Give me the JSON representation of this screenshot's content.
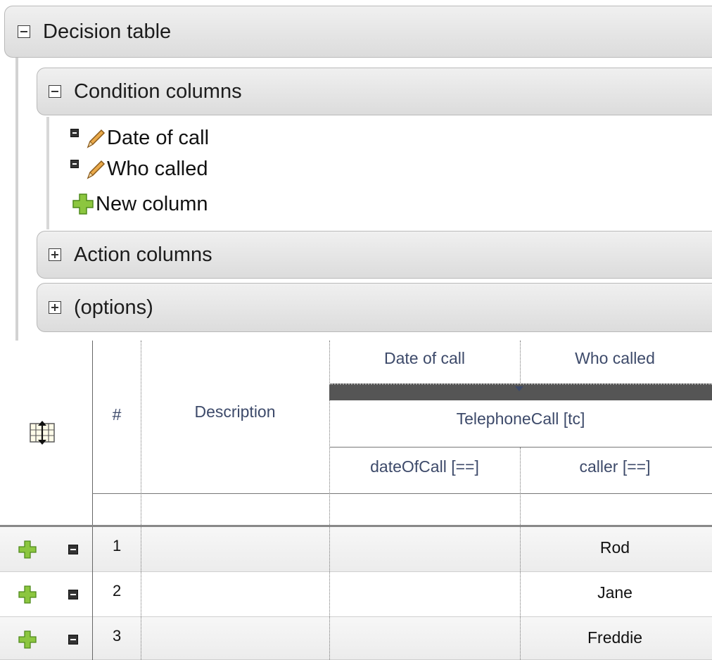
{
  "decision_table": {
    "title": "Decision table"
  },
  "condition_columns": {
    "title": "Condition columns",
    "items": [
      {
        "label": "Date of call"
      },
      {
        "label": "Who called"
      }
    ],
    "new_column_label": "New column"
  },
  "action_columns": {
    "title": "Action columns"
  },
  "options": {
    "title": "(options)"
  },
  "grid": {
    "headers": {
      "number": "#",
      "description": "Description",
      "col1": "Date of call",
      "col2": "Who called",
      "pattern": "TelephoneCall [tc]",
      "col1_field": "dateOfCall [==]",
      "col2_field": "caller [==]"
    },
    "rows": [
      {
        "num": "1",
        "who_called": "Rod"
      },
      {
        "num": "2",
        "who_called": "Jane"
      },
      {
        "num": "3",
        "who_called": "Freddie"
      }
    ]
  }
}
